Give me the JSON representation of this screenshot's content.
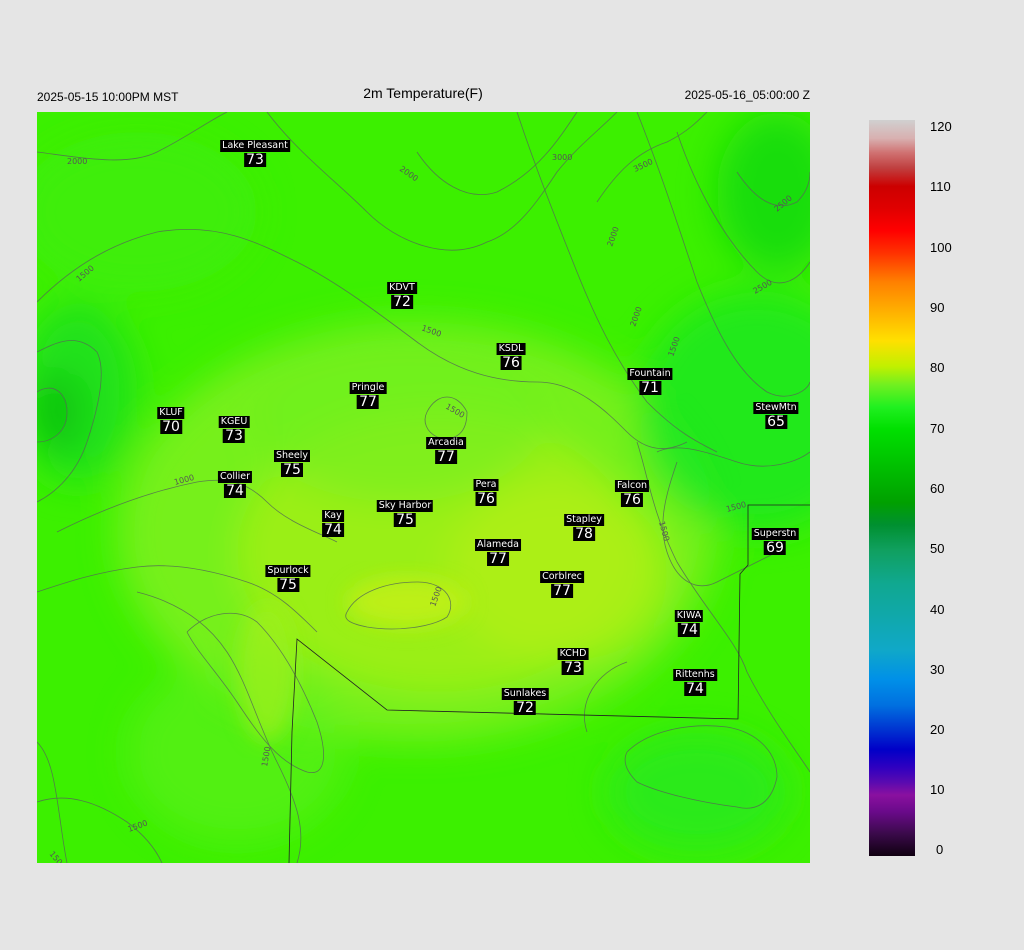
{
  "header": {
    "left_time": "2025-05-15 10:00PM MST",
    "title": "2m Temperature(F)",
    "right_time": "2025-05-16_05:00:00 Z"
  },
  "colorbar": {
    "ticks": [
      "120",
      "110",
      "100",
      "90",
      "80",
      "70",
      "60",
      "50",
      "40",
      "30",
      "20",
      "10",
      "0"
    ],
    "range": [
      0,
      120
    ]
  },
  "contour_labels": [
    "2000",
    "2000",
    "2500",
    "3000",
    "3500",
    "2500",
    "2000",
    "1500",
    "1500",
    "1500",
    "1000",
    "1500",
    "1500",
    "1500",
    "2000",
    "1500",
    "1500",
    "1500",
    "1500"
  ],
  "stations": [
    {
      "name": "Lake Pleasant",
      "temp": "73"
    },
    {
      "name": "KDVT",
      "temp": "72"
    },
    {
      "name": "KSDL",
      "temp": "76"
    },
    {
      "name": "Fountain",
      "temp": "71"
    },
    {
      "name": "StewMtn",
      "temp": "65"
    },
    {
      "name": "Pringle",
      "temp": "77"
    },
    {
      "name": "KLUF",
      "temp": "70"
    },
    {
      "name": "KGEU",
      "temp": "73"
    },
    {
      "name": "Arcadia",
      "temp": "77"
    },
    {
      "name": "Sheely",
      "temp": "75"
    },
    {
      "name": "Collier",
      "temp": "74"
    },
    {
      "name": "Pera",
      "temp": "76"
    },
    {
      "name": "Falcon",
      "temp": "76"
    },
    {
      "name": "Kay",
      "temp": "74"
    },
    {
      "name": "Sky Harbor",
      "temp": "75"
    },
    {
      "name": "Stapley",
      "temp": "78"
    },
    {
      "name": "Superstn",
      "temp": "69"
    },
    {
      "name": "Alameda",
      "temp": "77"
    },
    {
      "name": "Spurlock",
      "temp": "75"
    },
    {
      "name": "Corblrec",
      "temp": "77"
    },
    {
      "name": "KIWA",
      "temp": "74"
    },
    {
      "name": "KCHD",
      "temp": "73"
    },
    {
      "name": "Rittenhs",
      "temp": "74"
    },
    {
      "name": "Sunlakes",
      "temp": "72"
    }
  ]
}
